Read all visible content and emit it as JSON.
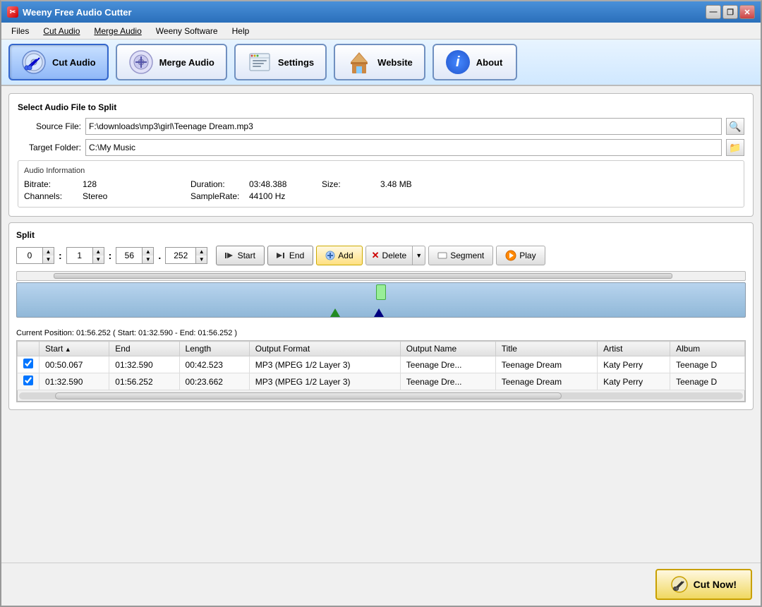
{
  "window": {
    "title": "Weeny Free Audio Cutter",
    "titleIcon": "✂",
    "minimizeBtn": "—",
    "restoreBtn": "❐",
    "closeBtn": "✕"
  },
  "menuBar": {
    "items": [
      "Files",
      "Cut Audio",
      "Merge Audio",
      "Weeny Software",
      "Help"
    ]
  },
  "toolbar": {
    "buttons": [
      {
        "id": "cut-audio",
        "label": "Cut Audio",
        "active": true
      },
      {
        "id": "merge-audio",
        "label": "Merge Audio",
        "active": false
      },
      {
        "id": "settings",
        "label": "Settings",
        "active": false
      },
      {
        "id": "website",
        "label": "Website",
        "active": false
      },
      {
        "id": "about",
        "label": "About",
        "active": false
      }
    ]
  },
  "splitSection": {
    "title": "Select Audio File to Split",
    "sourceLabel": "Source File:",
    "sourceValue": "F:\\downloads\\mp3\\girl\\Teenage Dream.mp3",
    "targetLabel": "Target Folder:",
    "targetValue": "C:\\My Music",
    "audioInfo": {
      "title": "Audio Information",
      "bitrateLabel": "Bitrate:",
      "bitrateValue": "128",
      "durationLabel": "Duration:",
      "durationValue": "03:48.388",
      "sizeLabel": "Size:",
      "sizeValue": "3.48 MB",
      "channelsLabel": "Channels:",
      "channelsValue": "Stereo",
      "sampleRateLabel": "SampleRate:",
      "sampleRateValue": "44100 Hz"
    }
  },
  "split": {
    "title": "Split",
    "time": {
      "minutes": "0",
      "minutesSpin": true,
      "seconds1": "1",
      "seconds2": "56",
      "frames": "252"
    },
    "buttons": {
      "start": "Start",
      "end": "End",
      "add": "Add",
      "delete": "Delete",
      "segment": "Segment",
      "play": "Play"
    },
    "positionText": "Current Position: 01:56.252 ( Start: 01:32.590 - End: 01:56.252 )"
  },
  "table": {
    "columns": [
      "",
      "Start",
      "End",
      "Length",
      "Output Format",
      "Output Name",
      "Title",
      "Artist",
      "Album"
    ],
    "rows": [
      {
        "checked": true,
        "start": "00:50.067",
        "end": "01:32.590",
        "length": "00:42.523",
        "format": "MP3 (MPEG 1/2 Layer 3)",
        "outputName": "Teenage Dre...",
        "title": "Teenage Dream",
        "artist": "Katy Perry",
        "album": "Teenage D"
      },
      {
        "checked": true,
        "start": "01:32.590",
        "end": "01:56.252",
        "length": "00:23.662",
        "format": "MP3 (MPEG 1/2 Layer 3)",
        "outputName": "Teenage Dre...",
        "title": "Teenage Dream",
        "artist": "Katy Perry",
        "album": "Teenage D"
      }
    ]
  },
  "cutNow": {
    "label": "Cut Now!"
  }
}
